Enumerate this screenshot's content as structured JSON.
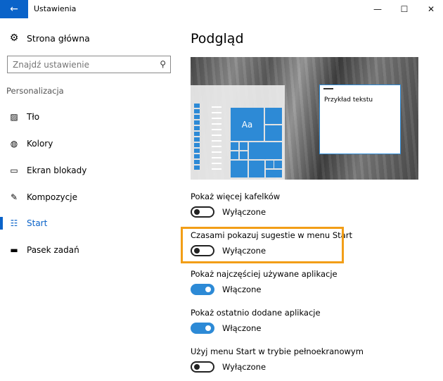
{
  "window": {
    "title": "Ustawienia",
    "back_glyph": "←",
    "minimize_glyph": "—",
    "maximize_glyph": "☐",
    "close_glyph": "✕"
  },
  "sidebar": {
    "home_label": "Strona główna",
    "search_placeholder": "Znajdź ustawienie",
    "section_label": "Personalizacja",
    "items": [
      {
        "label": "Tło",
        "icon": "image-icon",
        "active": false
      },
      {
        "label": "Kolory",
        "icon": "palette-icon",
        "active": false
      },
      {
        "label": "Ekran blokady",
        "icon": "lock-screen-icon",
        "active": false
      },
      {
        "label": "Kompozycje",
        "icon": "themes-icon",
        "active": false
      },
      {
        "label": "Start",
        "icon": "start-icon",
        "active": true
      },
      {
        "label": "Pasek zadań",
        "icon": "taskbar-icon",
        "active": false
      }
    ]
  },
  "main": {
    "title": "Podgląd",
    "preview": {
      "tile_label": "Aa",
      "sample_text": "Przykład tekstu"
    },
    "settings": [
      {
        "label": "Pokaż więcej kafelków",
        "state": "Wyłączone",
        "on": false
      },
      {
        "label": "Czasami pokazuj sugestie w menu Start",
        "state": "Wyłączone",
        "on": false
      },
      {
        "label": "Pokaż najczęściej używane aplikacje",
        "state": "Włączone",
        "on": true
      },
      {
        "label": "Pokaż ostatnio dodane aplikacje",
        "state": "Włączone",
        "on": true
      },
      {
        "label": "Użyj menu Start w trybie pełnoekranowym",
        "state": "Wyłączone",
        "on": false
      }
    ]
  },
  "colors": {
    "accent": "#0a63c9",
    "toggle_on": "#2d8ad6",
    "highlight": "#f29e17"
  }
}
